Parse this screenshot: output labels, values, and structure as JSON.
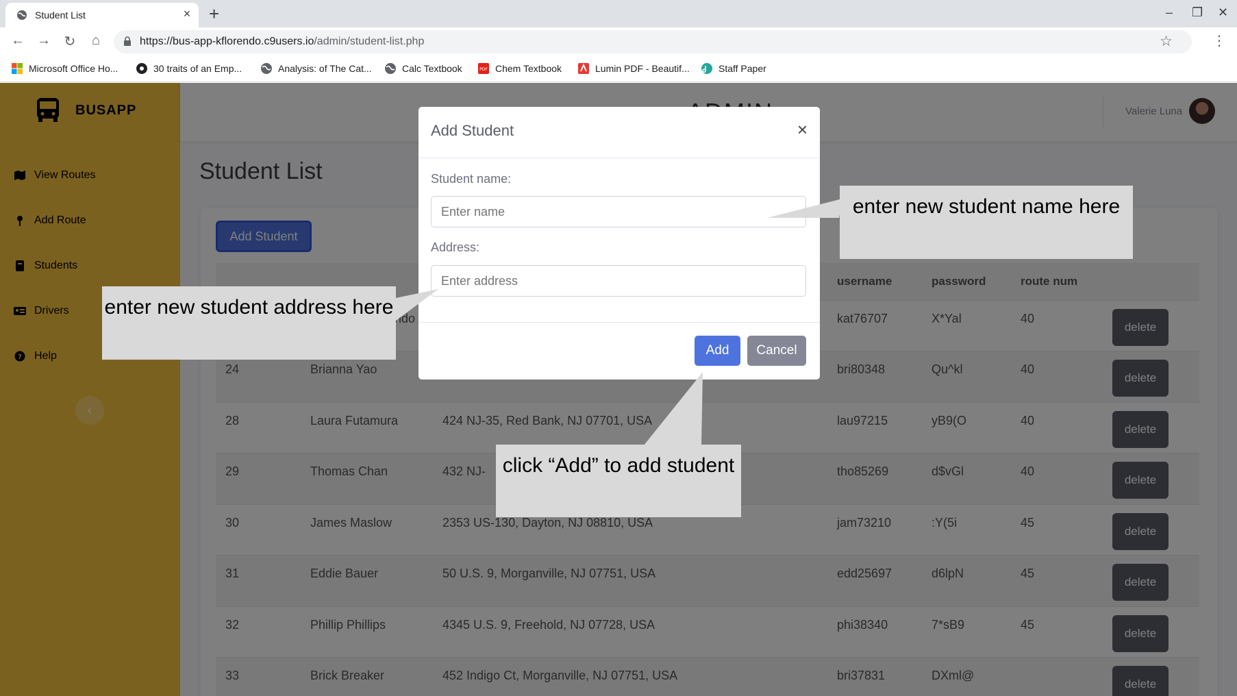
{
  "browser": {
    "tab_title": "Student List",
    "tab_close": "×",
    "new_tab": "+",
    "url_host": "https://bus-app-kflorendo.c9users.io",
    "url_path": "/admin/student-list.php",
    "window_controls": {
      "minimize": "–",
      "restore": "❐",
      "close": "✕"
    },
    "nav": {
      "back": "←",
      "forward": "→",
      "reload": "↻",
      "home": "⌂"
    },
    "bookmark_star": "☆",
    "menu": "⋮",
    "bookmarks": [
      {
        "label": "Microsoft Office Ho...",
        "icon": "microsoft-icon"
      },
      {
        "label": "30 traits of an Emp...",
        "icon": "globe-dark-icon"
      },
      {
        "label": "Analysis: of The Cat...",
        "icon": "globe-icon"
      },
      {
        "label": "Calc Textbook",
        "icon": "globe-icon"
      },
      {
        "label": "Chem Textbook",
        "icon": "pdf-icon"
      },
      {
        "label": "Lumin PDF - Beautif...",
        "icon": "lumin-icon"
      },
      {
        "label": "Staff Paper",
        "icon": "staff-icon"
      }
    ]
  },
  "app": {
    "brand": "BUSAPP",
    "header_title": "ADMIN",
    "user_name": "Valerie Luna",
    "page_title": "Student List",
    "add_student_label": "Add Student",
    "collapse_label": "‹",
    "sidebar": [
      {
        "label": "View Routes",
        "icon": "map-icon"
      },
      {
        "label": "Add Route",
        "icon": "map-pin-icon"
      },
      {
        "label": "Students",
        "icon": "book-icon"
      },
      {
        "label": "Drivers",
        "icon": "id-card-icon"
      },
      {
        "label": "Help",
        "icon": "question-circle-icon"
      }
    ],
    "table": {
      "headers": [
        "",
        "",
        "",
        "username",
        "password",
        "route num",
        ""
      ],
      "delete_label": "delete",
      "rows": [
        {
          "id": "",
          "name": "ndo",
          "address": "",
          "username": "kat76707",
          "password": "X*Yal",
          "route": "40"
        },
        {
          "id": "24",
          "name": "Brianna Yao",
          "address": "455 County Rd 520, Marlboro Township, NJ 07746, USA",
          "username": "bri80348",
          "password": "Qu^kl",
          "route": "40"
        },
        {
          "id": "28",
          "name": "Laura Futamura",
          "address": "424 NJ-35, Red Bank, NJ 07701, USA",
          "username": "lau97215",
          "password": "yB9(O",
          "route": "40"
        },
        {
          "id": "29",
          "name": "Thomas Chan",
          "address": "432 NJ-",
          "username": "tho85269",
          "password": "d$vGl",
          "route": "40"
        },
        {
          "id": "30",
          "name": "James Maslow",
          "address": "2353 US-130, Dayton, NJ 08810, USA",
          "username": "jam73210",
          "password": ":Y(5i",
          "route": "45"
        },
        {
          "id": "31",
          "name": "Eddie Bauer",
          "address": "50 U.S. 9, Morganville, NJ 07751, USA",
          "username": "edd25697",
          "password": "d6lpN",
          "route": "45"
        },
        {
          "id": "32",
          "name": "Phillip Phillips",
          "address": "4345 U.S. 9, Freehold, NJ 07728, USA",
          "username": "phi38340",
          "password": "7*sB9",
          "route": "45"
        },
        {
          "id": "33",
          "name": "Brick Breaker",
          "address": "452 Indigo Ct, Morganville, NJ 07751, USA",
          "username": "bri37831",
          "password": "DXml@",
          "route": ""
        }
      ]
    }
  },
  "modal": {
    "title": "Add Student",
    "close": "×",
    "name_label": "Student name:",
    "name_placeholder": "Enter name",
    "address_label": "Address:",
    "address_placeholder": "Enter address",
    "add_label": "Add",
    "cancel_label": "Cancel"
  },
  "callouts": {
    "name": "enter new student name here",
    "address": "enter new student address here",
    "add": "click “Add” to add student"
  },
  "colors": {
    "sidebar": "#f6c23e",
    "primary": "#4e73df",
    "secondary": "#858796",
    "callout": "#d9d9d9"
  }
}
